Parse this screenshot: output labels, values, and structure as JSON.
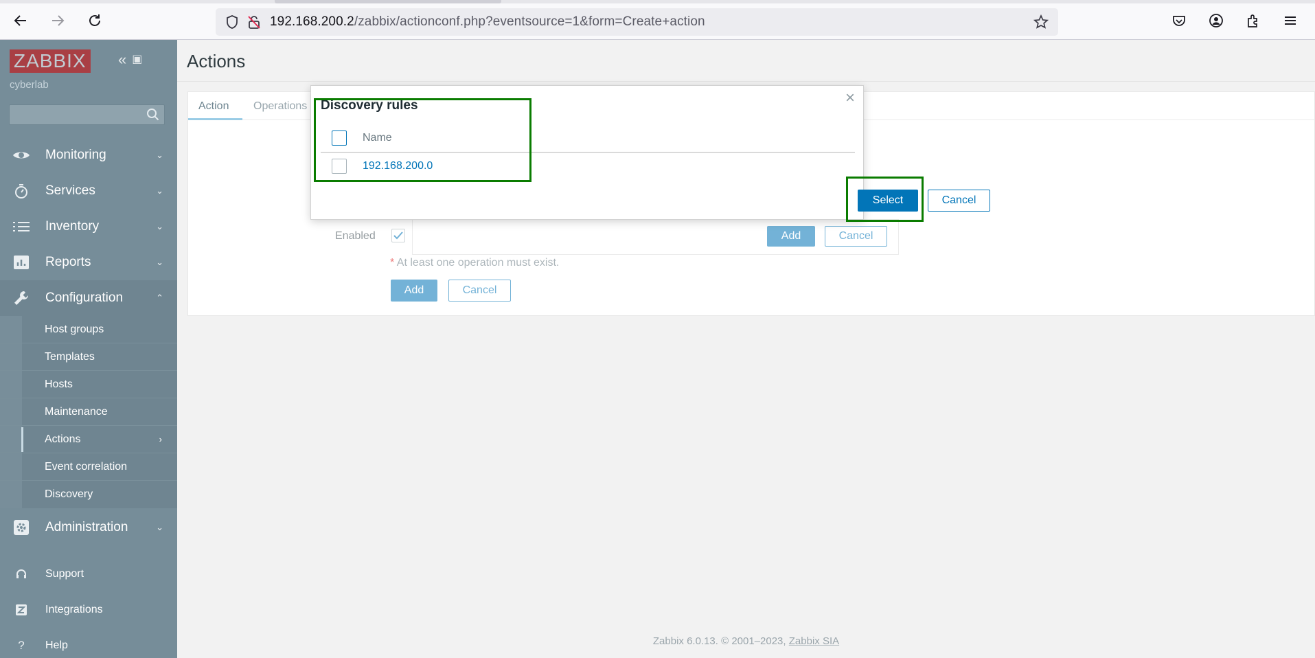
{
  "browser": {
    "url_host": "192.168.200.2",
    "url_path": "/zabbix/actionconf.php?eventsource=1&form=Create+action"
  },
  "sidebar": {
    "logo": "ZABBIX",
    "server_name": "cyberlab",
    "menu": [
      {
        "label": "Monitoring",
        "icon": "eye-icon"
      },
      {
        "label": "Services",
        "icon": "stopwatch-icon"
      },
      {
        "label": "Inventory",
        "icon": "list-icon"
      },
      {
        "label": "Reports",
        "icon": "bar-chart-icon"
      },
      {
        "label": "Configuration",
        "icon": "wrench-icon"
      }
    ],
    "submenu": [
      {
        "label": "Host groups"
      },
      {
        "label": "Templates"
      },
      {
        "label": "Hosts"
      },
      {
        "label": "Maintenance"
      },
      {
        "label": "Actions"
      },
      {
        "label": "Event correlation"
      },
      {
        "label": "Discovery"
      }
    ],
    "administration": "Administration",
    "footer": [
      {
        "label": "Support",
        "icon": "headset-icon"
      },
      {
        "label": "Integrations",
        "icon": "z-icon"
      },
      {
        "label": "Help",
        "icon": "question-icon"
      }
    ]
  },
  "main": {
    "title": "Actions",
    "tabs": [
      "Action",
      "Operations"
    ],
    "enabled_label": "Enabled",
    "inner_add": "Add",
    "inner_cancel": "Cancel",
    "note": "At least one operation must exist.",
    "form_add": "Add",
    "form_cancel": "Cancel",
    "footer_text": "Zabbix 6.0.13. © 2001–2023, ",
    "footer_link": "Zabbix SIA"
  },
  "modal": {
    "title": "Discovery rules",
    "column_name": "Name",
    "rows": [
      "192.168.200.0"
    ],
    "select_label": "Select",
    "cancel_label": "Cancel",
    "close_glyph": "×"
  }
}
